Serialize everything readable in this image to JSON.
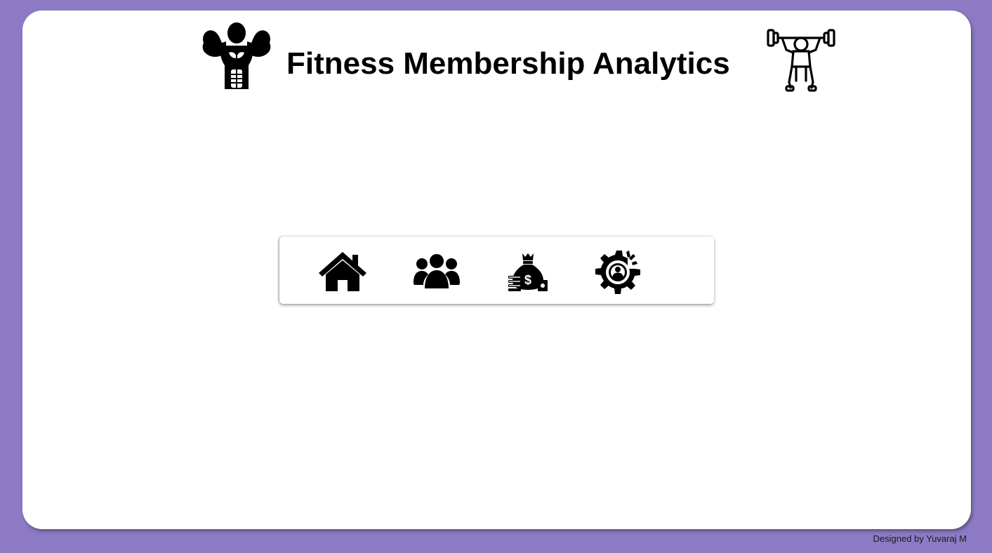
{
  "header": {
    "title": "Fitness Membership Analytics",
    "left_icon": "bodybuilder-icon",
    "right_icon": "weightlifter-icon"
  },
  "nav": {
    "items": [
      {
        "name": "home",
        "icon": "home-icon"
      },
      {
        "name": "members",
        "icon": "users-group-icon"
      },
      {
        "name": "revenue",
        "icon": "money-bag-icon"
      },
      {
        "name": "settings",
        "icon": "gear-user-icon"
      }
    ]
  },
  "footer": {
    "credit": "Designed by Yuvaraj M"
  },
  "colors": {
    "frame": "#8c7bc4",
    "panel": "#ffffff",
    "icon": "#000000"
  }
}
